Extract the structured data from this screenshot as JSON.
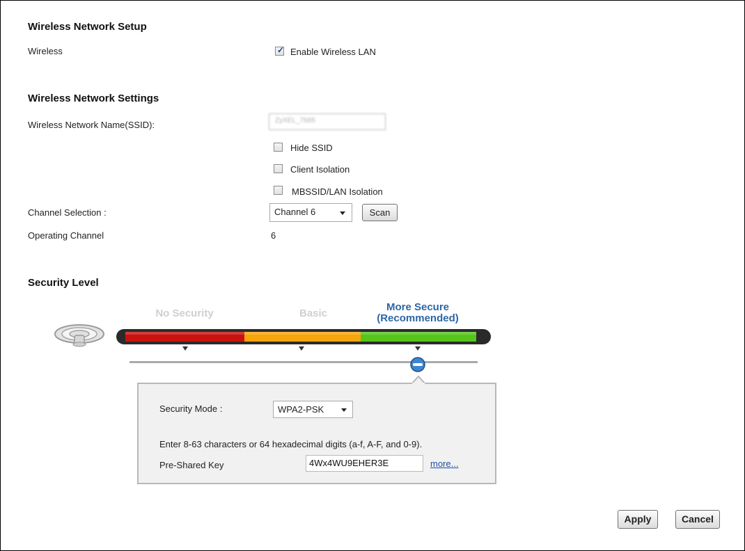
{
  "setup": {
    "title": "Wireless Network Setup",
    "wireless_label": "Wireless",
    "enable_wireless_label": "Enable Wireless LAN",
    "enable_wireless_checked": true
  },
  "settings": {
    "title": "Wireless Network Settings",
    "ssid_label": "Wireless Network Name(SSID):",
    "ssid_value": "ZyXEL_7665",
    "hide_ssid_label": "Hide SSID",
    "client_isolation_label": "Client Isolation",
    "mbssid_label": "MBSSID/LAN Isolation",
    "channel_selection_label": "Channel Selection :",
    "channel_value": "Channel 6",
    "scan_label": "Scan",
    "operating_channel_label": "Operating Channel",
    "operating_channel_value": "6"
  },
  "security": {
    "title": "Security Level",
    "levels": [
      "No Security",
      "Basic",
      "More Secure",
      "(Recommended)"
    ],
    "selected_level_index": 2,
    "icon": "wifi-router-icon",
    "mode_label": "Security Mode :",
    "mode_value": "WPA2-PSK",
    "hint": "Enter 8-63 characters or 64 hexadecimal digits (a-f, A-F, and 0-9).",
    "psk_label": "Pre-Shared Key",
    "psk_value": "4Wx4WU9EHER3E",
    "more_link": "more...",
    "colors": {
      "low": "#c8120e",
      "mid": "#f6a50c",
      "high": "#55c51c",
      "accent": "#2d66a8"
    }
  },
  "actions": {
    "apply_label": "Apply",
    "cancel_label": "Cancel"
  }
}
